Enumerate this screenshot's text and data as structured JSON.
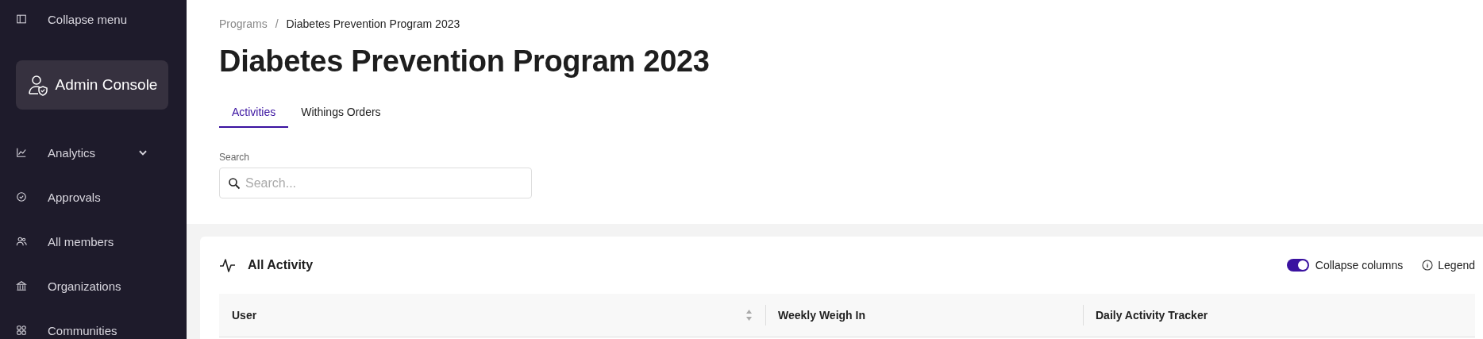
{
  "sidebar": {
    "collapse_label": "Collapse menu",
    "console_button": "Admin Console",
    "items": [
      {
        "label": "Analytics",
        "expandable": true
      },
      {
        "label": "Approvals",
        "expandable": false
      },
      {
        "label": "All members",
        "expandable": false
      },
      {
        "label": "Organizations",
        "expandable": false
      },
      {
        "label": "Communities",
        "expandable": false
      }
    ]
  },
  "breadcrumb": [
    "Programs",
    "/",
    "Diabetes Prevention Program 2023"
  ],
  "page_title": "Diabetes Prevention Program 2023",
  "tabs": [
    {
      "label": "Activities",
      "selected": true
    },
    {
      "label": "Withings Orders",
      "selected": false
    }
  ],
  "search": {
    "label": "Search",
    "placeholder": "Search..."
  },
  "card": {
    "title": "All Activity",
    "toggle": {
      "label": "Collapse columns",
      "on": true
    },
    "legend": "Legend",
    "columns": [
      {
        "label": "User",
        "sortable": true
      },
      {
        "label": "Weekly Weigh In",
        "sortable": false
      },
      {
        "label": "Daily Activity Tracker",
        "sortable": false
      }
    ]
  }
}
